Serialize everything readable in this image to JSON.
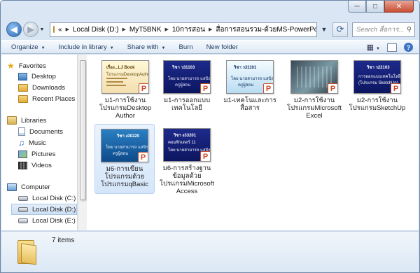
{
  "window": {
    "minimize": "─",
    "maximize": "□",
    "close": "✕"
  },
  "address": {
    "overflow": "«",
    "crumbs": [
      "Local Disk (D:)",
      "MyT5BNK",
      "10การสอน",
      "สื่อการสอนรวม-ด้วยMS-PowerPoint"
    ],
    "search_placeholder": "Search สื่อการ..."
  },
  "toolbar": {
    "organize": "Organize",
    "include": "Include in library",
    "share": "Share with",
    "burn": "Burn",
    "new_folder": "New folder",
    "help": "?"
  },
  "nav": {
    "favorites": "Favorites",
    "desktop": "Desktop",
    "downloads": "Downloads",
    "recent": "Recent Places",
    "libraries": "Libraries",
    "documents": "Documents",
    "music": "Music",
    "pictures": "Pictures",
    "videos": "Videos",
    "computer": "Computer",
    "drive_c": "Local Disk (C:)",
    "drive_d": "Local Disk (D:)",
    "drive_e": "Local Disk (E:)"
  },
  "files": [
    {
      "name": "ม1-การใช้งานโปรแกรมDesktop Author",
      "thumb_title": "เรื่อง...LJ Book",
      "thumb_sub": "โปรแกรมDesktopAuthor"
    },
    {
      "name": "ม1-การออกแบบเทคโนโลยี",
      "thumb_title": "วิชา ว31103",
      "thumb_sub": "โดย นายสามารถ แสนิรม",
      "thumb_foot": "ครูผู้สอน"
    },
    {
      "name": "ม1-เทคโนและการสื่อสาร",
      "thumb_title": "วิชา ว31101",
      "thumb_sub": "โดย นายสามารถ แสนิรม",
      "thumb_foot": "ครูผู้สอน"
    },
    {
      "name": "ม2-การใช้งานโปรแกรมMicrosoft Excel",
      "thumb_title": "",
      "thumb_sub": ""
    },
    {
      "name": "ม2-การใช้งานโปรแกรมSketchUp",
      "thumb_title": "วิชา ว22103",
      "thumb_sub": "การออกแบบเทคโนโลยี 2",
      "thumb_foot": "(โปรแกรม SketchUp)"
    },
    {
      "name": "ม6-การเขียนโปรแกรมด้วยโปรแกรมqBasic",
      "thumb_title": "วิชา ง30220",
      "thumb_sub": "โดย นายสามารถ แสนิรม",
      "thumb_foot": "ครูผู้สอน"
    },
    {
      "name": "ม6-การสร้างฐานข้อมูลด้วยโปรแกรมMicrosoftAccess",
      "thumb_title": "วิชา ง33201",
      "thumb_sub": "คอมพิวเตอร์ 11",
      "thumb_foot": "โดย นายสามารถ แสนิรม"
    }
  ],
  "status": {
    "count": "7 items"
  }
}
